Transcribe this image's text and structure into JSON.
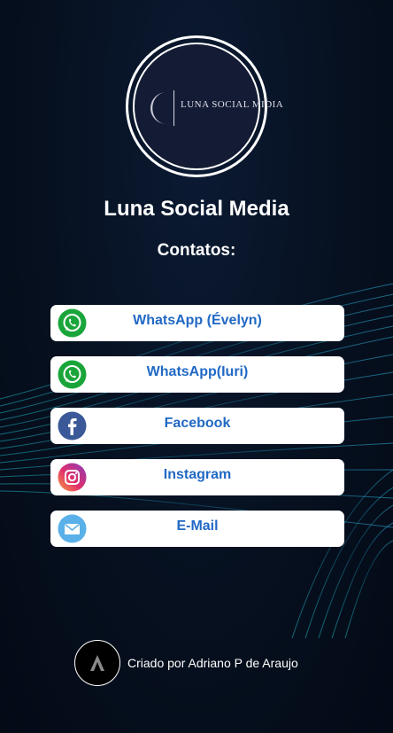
{
  "profile": {
    "logo_text": "LUNA SOCIAL MIDIA",
    "name": "Luna Social Media"
  },
  "contacts_heading": "Contatos:",
  "links": [
    {
      "label": "WhatsApp (Évelyn)",
      "icon": "whatsapp-icon"
    },
    {
      "label": "WhatsApp(Iuri)",
      "icon": "whatsapp-icon"
    },
    {
      "label": "Facebook",
      "icon": "facebook-icon"
    },
    {
      "label": "Instagram",
      "icon": "instagram-icon"
    },
    {
      "label": "E-Mail",
      "icon": "email-icon"
    }
  ],
  "footer": {
    "credit": "Criado por Adriano P de Araujo",
    "avatar_letter": "A"
  },
  "colors": {
    "background": "#06101f",
    "button_bg": "#ffffff",
    "button_text": "#2169c4",
    "whatsapp": "#1aa53a",
    "facebook": "#3b5998",
    "email": "#5ab0e8"
  }
}
